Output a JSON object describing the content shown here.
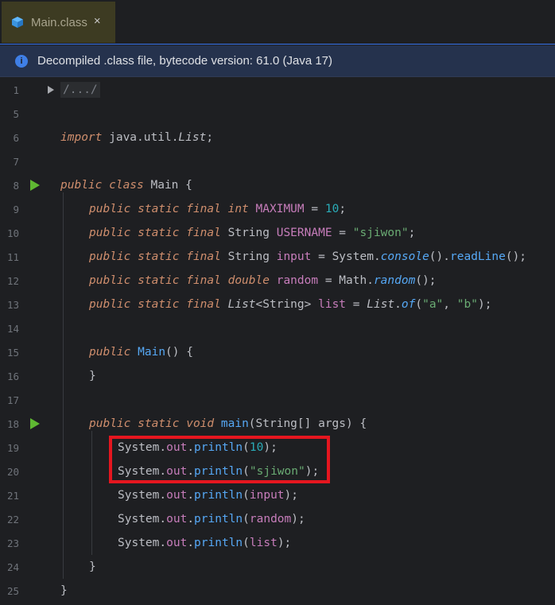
{
  "tab": {
    "name": "Main.class",
    "close": "×",
    "icon": "class-file-icon"
  },
  "banner": {
    "icon": "info-icon",
    "text": "Decompiled .class file, bytecode version: 61.0 (Java 17)"
  },
  "lines": [
    {
      "n": "1",
      "text": "/.../"
    },
    {
      "n": "5",
      "text": ""
    },
    {
      "n": "6",
      "text": "import java.util.List;"
    },
    {
      "n": "7",
      "text": ""
    },
    {
      "n": "8",
      "text": "public class Main {"
    },
    {
      "n": "9",
      "text": "    public static final int MAXIMUM = 10;"
    },
    {
      "n": "10",
      "text": "    public static final String USERNAME = \"sjiwon\";"
    },
    {
      "n": "11",
      "text": "    public static final String input = System.console().readLine();"
    },
    {
      "n": "12",
      "text": "    public static final double random = Math.random();"
    },
    {
      "n": "13",
      "text": "    public static final List<String> list = List.of(\"a\", \"b\");"
    },
    {
      "n": "14",
      "text": ""
    },
    {
      "n": "15",
      "text": "    public Main() {"
    },
    {
      "n": "16",
      "text": "    }"
    },
    {
      "n": "17",
      "text": ""
    },
    {
      "n": "18",
      "text": "    public static void main(String[] args) {"
    },
    {
      "n": "19",
      "text": "        System.out.println(10);"
    },
    {
      "n": "20",
      "text": "        System.out.println(\"sjiwon\");"
    },
    {
      "n": "21",
      "text": "        System.out.println(input);"
    },
    {
      "n": "22",
      "text": "        System.out.println(random);"
    },
    {
      "n": "23",
      "text": "        System.out.println(list);"
    },
    {
      "n": "24",
      "text": "    }"
    },
    {
      "n": "25",
      "text": "}"
    }
  ],
  "run_lines": [
    "8",
    "18"
  ],
  "highlight": {
    "lines": [
      "19",
      "20"
    ],
    "color": "#e5161f"
  }
}
